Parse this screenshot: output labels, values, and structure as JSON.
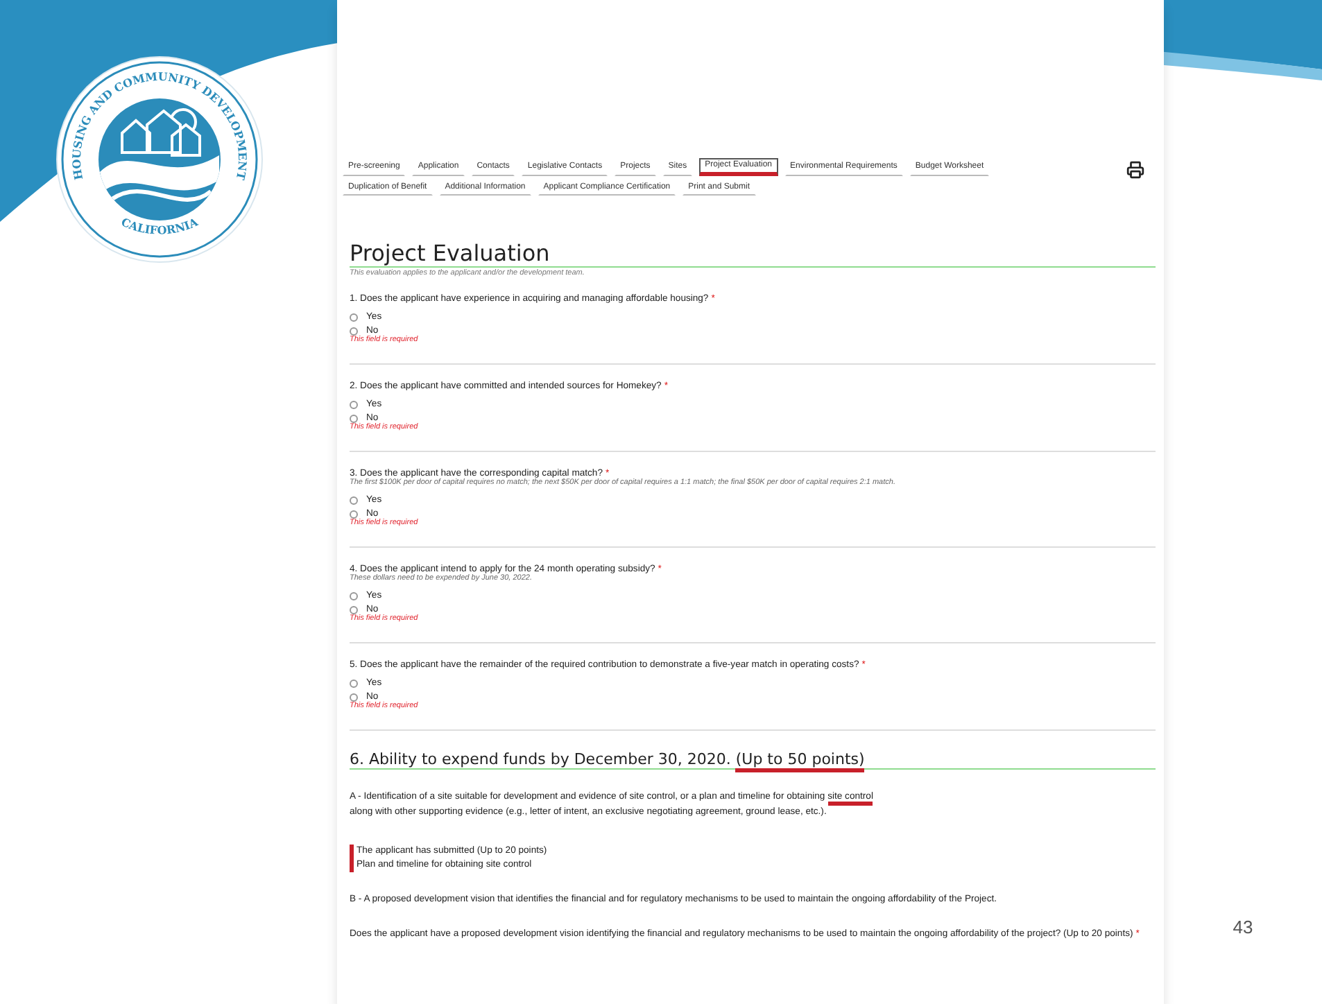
{
  "logo": {
    "ring_top": "HOUSING AND COMMUNITY DEVELOPMENT",
    "ring_bottom": "CALIFORNIA"
  },
  "tab_rows": [
    [
      {
        "label": "Pre-screening",
        "selected": false
      },
      {
        "label": "Application",
        "selected": false
      },
      {
        "label": "Contacts",
        "selected": false
      },
      {
        "label": "Legislative Contacts",
        "selected": false
      },
      {
        "label": "Projects",
        "selected": false
      },
      {
        "label": "Sites",
        "selected": false
      },
      {
        "label": "Project Evaluation",
        "selected": true
      },
      {
        "label": "Environmental Requirements",
        "selected": false
      },
      {
        "label": "Budget Worksheet",
        "selected": false
      }
    ],
    [
      {
        "label": "Duplication of Benefit",
        "selected": false
      },
      {
        "label": "Additional Information",
        "selected": false
      },
      {
        "label": "Applicant Compliance Certification",
        "selected": false
      },
      {
        "label": "Print and Submit",
        "selected": false
      }
    ]
  ],
  "page_title": "Project Evaluation",
  "page_subtitle": "This evaluation applies to the applicant and/or the development team.",
  "questions": [
    {
      "text": "1. Does the applicant have experience in acquiring and managing affordable housing?",
      "required_mark": "*",
      "options": [
        {
          "label": "Yes",
          "selected": false
        },
        {
          "label": "No",
          "selected": false
        }
      ],
      "error": "This field is required"
    },
    {
      "text": "2. Does the applicant have committed and intended sources for Homekey?",
      "required_mark": "*",
      "options": [
        {
          "label": "Yes",
          "selected": false
        },
        {
          "label": "No",
          "selected": false
        }
      ],
      "error": "This field is required"
    },
    {
      "text": "3. Does the applicant have the corresponding capital match?",
      "required_mark": "*",
      "hint": "The first $100K per door of capital requires no match; the next $50K per door of capital requires a 1:1 match; the final $50K per door of capital requires 2:1 match.",
      "options": [
        {
          "label": "Yes",
          "selected": false
        },
        {
          "label": "No",
          "selected": false
        }
      ],
      "error": "This field is required"
    },
    {
      "text": "4. Does the applicant intend to apply for the 24 month operating subsidy?",
      "required_mark": "*",
      "hint": "These dollars need to be expended by June 30, 2022.",
      "options": [
        {
          "label": "Yes",
          "selected": false
        },
        {
          "label": "No",
          "selected": false
        }
      ],
      "error": "This field is required"
    },
    {
      "text": "5. Does the applicant have the remainder of the required contribution to demonstrate a five-year match in operating costs?",
      "required_mark": "*",
      "options": [
        {
          "label": "Yes",
          "selected": false
        },
        {
          "label": "No",
          "selected": false
        }
      ],
      "error": "This field is required"
    }
  ],
  "section": {
    "title_parts": [
      {
        "text": "6. Ability to expend funds by December 30, 2020.",
        "marked": false
      },
      {
        "text": "(Up to 50 points)",
        "marked": true
      }
    ],
    "blocks": [
      {
        "kind": "paragraph",
        "parts": [
          {
            "text": "A - Identification of a site suitable for development and evidence of site control, or a plan and timeline for obtaining",
            "marked": false
          },
          {
            "text": "site control",
            "marked": true
          },
          {
            "text": "along with other supporting evidence (e.g., letter of intent, an exclusive negotiating agreement, ground lease, etc.).",
            "marked": false
          }
        ]
      },
      {
        "kind": "flagged",
        "lines": [
          "The applicant has submitted (Up to 20 points)",
          "Plan and timeline for obtaining site control"
        ]
      },
      {
        "kind": "paragraph",
        "parts": [
          {
            "text": "B - A proposed development vision that identifies the financial and for regulatory mechanisms to be used to maintain the ongoing affordability of the Project.",
            "marked": false
          }
        ]
      },
      {
        "kind": "question",
        "text": "Does the applicant have a proposed development vision identifying the financial and regulatory mechanisms to be used to maintain the ongoing affordability of the project? (Up to 20 points)",
        "required_mark": "*"
      }
    ]
  },
  "slide_number": "43"
}
